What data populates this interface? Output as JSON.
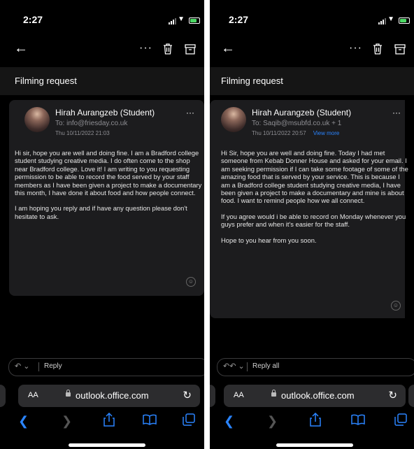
{
  "left": {
    "status": {
      "time": "2:27"
    },
    "subject": "Filming request",
    "email": {
      "sender": "Hirah Aurangzeb (Student)",
      "to": "To: info@friesday.co.uk",
      "date": "Thu 10/11/2022 21:03",
      "body": [
        "Hi sir, hope you are well and doing fine. I am a Bradford college student studying creative media. I do often come to the shop near Bradford college. Love it! I am writing to you requesting permission to be able to record the food served by your staff members as I have been given a project to make a documentary this month, I have done it about food and how people connect.",
        "I am hoping you reply and if have any question please don't hesitate to ask."
      ]
    },
    "reply_label": "Reply",
    "browser": {
      "aa": "AA",
      "url": "outlook.office.com"
    }
  },
  "right": {
    "status": {
      "time": "2:27"
    },
    "subject": "Filming request",
    "email": {
      "sender": "Hirah Aurangzeb (Student)",
      "to": "To: Saqib@msubfd.co.uk  + 1",
      "date": "Thu 10/11/2022 20:57",
      "view_more": "View more",
      "body": [
        "Hi Sir, hope you are well and doing fine. Today I had met someone from Kebab Donner House and asked for your email. I am seeking permission if I can take some footage of some of the amazing food that is served by your service. This is because I am a Bradford college student studying creative media, I have been given a project to make a documentary and mine is about food. I want to remind people how we all connect.",
        "If you agree would i be able to record on Monday whenever you guys prefer and when it's easier for the staff.",
        "Hope to you hear from you soon."
      ]
    },
    "reply_label": "Reply all",
    "browser": {
      "aa": "AA",
      "url": "outlook.office.com"
    }
  },
  "icons": {
    "back": "arrow-left-icon",
    "more": "more-horizontal-icon",
    "delete": "trash-icon",
    "archive": "archive-icon",
    "reply": "reply-icon",
    "reply_all": "reply-all-icon",
    "reload": "reload-icon",
    "nav": [
      "chevron-left-icon",
      "chevron-right-icon",
      "share-icon",
      "bookmarks-icon",
      "tabs-icon"
    ]
  },
  "colors": {
    "accent": "#2a84ff",
    "background": "#000000",
    "card": "#1c1c1e",
    "battery": "#4cd964"
  }
}
